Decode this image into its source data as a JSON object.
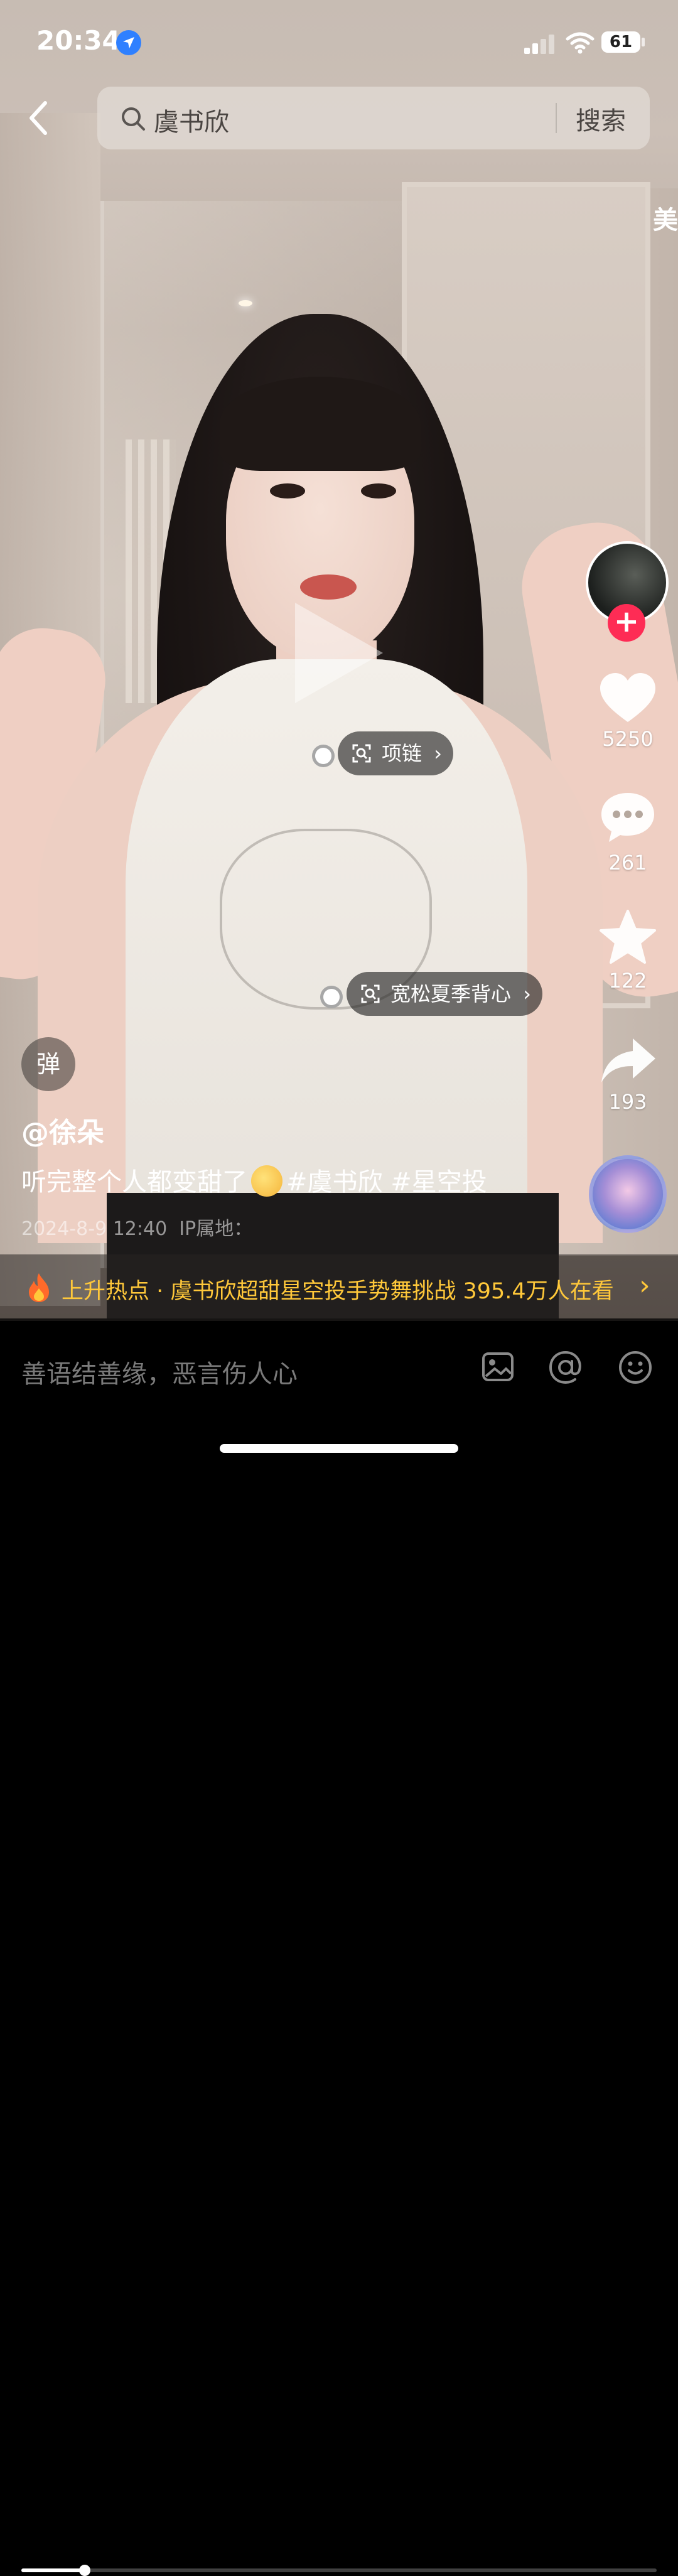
{
  "status_bar": {
    "time": "20:34",
    "battery": "61"
  },
  "search": {
    "query": "虞书欣",
    "button_label": "搜索"
  },
  "side_hint": "美",
  "product_tags": [
    {
      "label": "项链"
    },
    {
      "label": "宽松夏季背心"
    }
  ],
  "rail": {
    "likes": "5250",
    "comments": "261",
    "favorites": "122",
    "shares": "193"
  },
  "danmu_label": "弹",
  "post": {
    "author": "@徐朵",
    "caption_text": "听完整个人都变甜了",
    "hashtags": "#虞书欣 #星空投",
    "date": "2024-8-9 12:40",
    "ip_label": "IP属地："
  },
  "hot": {
    "text": "上升热点 · 虞书欣超甜星空投手势舞挑战 395.4万人在看"
  },
  "progress": {
    "fraction": 0.1
  },
  "comment": {
    "placeholder": "善语结善缘，恶言伤人心"
  },
  "colors": {
    "accent_red": "#fe2c55",
    "hot_yellow": "#ffc83a",
    "location_blue": "#2f80ff"
  },
  "icons": {
    "back": "chevron-left-icon",
    "search": "search-icon",
    "like": "heart-icon",
    "comment": "comment-bubble-icon",
    "favorite": "star-icon",
    "share": "share-arrow-icon",
    "image": "image-icon",
    "mention": "at-icon",
    "emoji": "emoji-icon"
  }
}
